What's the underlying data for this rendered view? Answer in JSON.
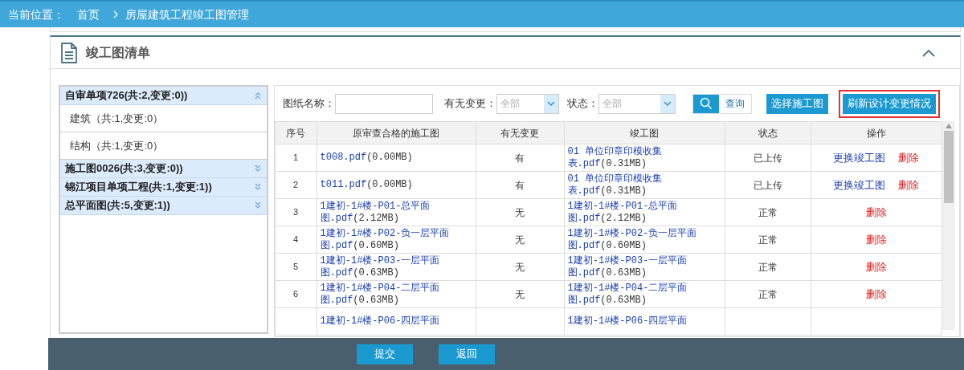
{
  "breadcrumb": {
    "label": "当前位置：",
    "items": [
      "首页",
      "房屋建筑工程竣工图管理"
    ]
  },
  "panel": {
    "title": "竣工图清单",
    "expanded": true
  },
  "sidebar": {
    "groups": [
      {
        "label": "自审单项726(共:2,变更:0))",
        "expanded": true,
        "children": [
          {
            "label": "建筑（共:1,变更:0）"
          },
          {
            "label": "结构（共:1,变更:0）"
          }
        ]
      },
      {
        "label": "施工图0026(共:3,变更:0))",
        "expanded": false
      },
      {
        "label": "锦江项目单项工程(共:1,变更:1))",
        "expanded": false
      },
      {
        "label": "总平面图(共:5,变更:1))",
        "expanded": false
      }
    ]
  },
  "filters": {
    "name_label": "图纸名称：",
    "change_label": "有无变更：",
    "change_value": "全部",
    "status_label": "状态：",
    "status_value": "全部"
  },
  "buttons": [
    {
      "kind": "search",
      "label": "查询"
    },
    {
      "kind": "plain",
      "label": "选择施工图"
    },
    {
      "kind": "plain",
      "label": "刷新设计变更情况",
      "highlighted": true
    }
  ],
  "table": {
    "columns": [
      "序号",
      "原审查合格的施工图",
      "有无变更",
      "竣工图",
      "状态",
      "操作"
    ],
    "rows": [
      {
        "no": "1",
        "original": {
          "file": "t008.pdf",
          "size": "(0.00MB)"
        },
        "changed": "有",
        "final": {
          "file": "01 单位印章印模收集表.pdf",
          "size": "(0.31MB)"
        },
        "status": "已上传",
        "actions": [
          {
            "kind": "link",
            "label": "更换竣工图"
          },
          {
            "kind": "danger",
            "label": "删除"
          }
        ]
      },
      {
        "no": "2",
        "original": {
          "file": "t011.pdf",
          "size": "(0.00MB)"
        },
        "changed": "有",
        "final": {
          "file": "01 单位印章印模收集表.pdf",
          "size": "(0.31MB)"
        },
        "status": "已上传",
        "actions": [
          {
            "kind": "link",
            "label": "更换竣工图"
          },
          {
            "kind": "danger",
            "label": "删除"
          }
        ]
      },
      {
        "no": "3",
        "original": {
          "file": "1建初-1#楼-P01-总平面图.pdf",
          "size": "(2.12MB)"
        },
        "changed": "无",
        "final": {
          "file": "1建初-1#楼-P01-总平面图.pdf",
          "size": "(2.12MB)"
        },
        "status": "正常",
        "actions": [
          {
            "kind": "danger",
            "label": "删除"
          }
        ]
      },
      {
        "no": "4",
        "original": {
          "file": "1建初-1#楼-P02-负一层平面图.pdf",
          "size": "(0.60MB)"
        },
        "changed": "无",
        "final": {
          "file": "1建初-1#楼-P02-负一层平面图.pdf",
          "size": "(0.60MB)"
        },
        "status": "正常",
        "actions": [
          {
            "kind": "danger",
            "label": "删除"
          }
        ]
      },
      {
        "no": "5",
        "original": {
          "file": "1建初-1#楼-P03-一层平面图.pdf",
          "size": "(0.63MB)"
        },
        "changed": "无",
        "final": {
          "file": "1建初-1#楼-P03-一层平面图.pdf",
          "size": "(0.63MB)"
        },
        "status": "正常",
        "actions": [
          {
            "kind": "danger",
            "label": "删除"
          }
        ]
      },
      {
        "no": "6",
        "original": {
          "file": "1建初-1#楼-P04-二层平面图.pdf",
          "size": "(0.63MB)"
        },
        "changed": "无",
        "final": {
          "file": "1建初-1#楼-P04-二层平面图.pdf",
          "size": "(0.63MB)"
        },
        "status": "正常",
        "actions": [
          {
            "kind": "danger",
            "label": "删除"
          }
        ]
      },
      {
        "original": {
          "file": "1建初-1#楼-P06-四层平面"
        },
        "final": {
          "file": "1建初-1#楼-P06-四层平面"
        }
      }
    ]
  },
  "footer": {
    "buttons": [
      "提交",
      "返回"
    ]
  }
}
